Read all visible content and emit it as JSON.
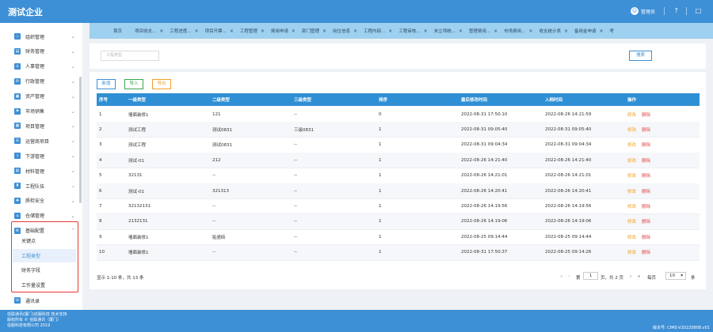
{
  "header": {
    "title": "测试企业",
    "user_name": "管理员",
    "help_icon": "?",
    "device_icon": "□"
  },
  "tabs": [
    "首页",
    "项目收支...",
    "工程进度...",
    "项目开票...",
    "工程管理",
    "费用申请",
    "部门管理",
    "岗位信息",
    "工程内部...",
    "工程审核...",
    "末立项统...",
    "管理费用...",
    "市场费用...",
    "收支统计表",
    "备用金申请",
    "考"
  ],
  "sidebar": {
    "items": [
      "组织管理",
      "财务管理",
      "人事管理",
      "行政管理",
      "资产管理",
      "市场销售",
      "项目管理",
      "运营商项目",
      "下游管理",
      "材料管理",
      "工程队伍",
      "质检安全",
      "仓储管理",
      "基础配置"
    ],
    "subitems": [
      "关键点",
      "工程类型",
      "财务字段",
      "工作量设置"
    ],
    "last_item": "通讯录"
  },
  "search": {
    "placeholder": "工程类型",
    "button": "搜索"
  },
  "actions": {
    "add": "新增",
    "import": "导入",
    "export": "导出"
  },
  "table": {
    "headers": [
      "序号",
      "一级类型",
      "二级类型",
      "三级类型",
      "排序",
      "最后修改时间",
      "入档时间",
      "操作"
    ],
    "rows": [
      [
        "1",
        "墙面装修1",
        "121",
        "--",
        "0",
        "2022-08-31 17:50:10",
        "2022-08-26 14:21:59"
      ],
      [
        "2",
        "测试工程",
        "测试0831",
        "三级0831",
        "1",
        "2022-08-31 09:05:40",
        "2022-08-31 09:05:40"
      ],
      [
        "3",
        "测试工程",
        "测试0831",
        "--",
        "1",
        "2022-08-31 09:04:34",
        "2022-08-31 09:04:34"
      ],
      [
        "4",
        "测试-01",
        "212",
        "--",
        "1",
        "2022-08-26 14:21:40",
        "2022-08-26 14:21:40"
      ],
      [
        "5",
        "32131",
        "--",
        "--",
        "1",
        "2022-08-26 14:21:01",
        "2022-08-26 14:21:01"
      ],
      [
        "6",
        "测试-01",
        "321313",
        "--",
        "1",
        "2022-08-26 14:20:41",
        "2022-08-26 14:20:41"
      ],
      [
        "7",
        "32132131",
        "--",
        "--",
        "1",
        "2022-08-26 14:19:56",
        "2022-08-26 14:19:56"
      ],
      [
        "8",
        "2132131",
        "--",
        "--",
        "1",
        "2022-08-26 14:19:06",
        "2022-08-26 14:19:06"
      ],
      [
        "9",
        "墙面装修1",
        "贴瓷砖",
        "--",
        "1",
        "2022-08-25 09:14:44",
        "2022-08-25 09:14:44"
      ],
      [
        "10",
        "墙面装修1",
        "--",
        "--",
        "1",
        "2022-08-31 17:50:37",
        "2022-08-25 09:14:26"
      ]
    ],
    "edit_label": "修改",
    "delete_label": "删除"
  },
  "pagination": {
    "summary": "显示 1-10 条，共 13 条",
    "first": "«",
    "prev": "‹",
    "page_label": "第",
    "page": "1",
    "total_pages": "页，共 2 页",
    "next": "›",
    "last": "»",
    "per_page_label": "每页",
    "per_page": "10",
    "per_page_unit": "条"
  },
  "footer": {
    "line1": "信联通讯(厦门)信服科技 技术支持",
    "line2": "版权所有 © 信联通讯（厦门）",
    "line3": "信服科技有限公司 2019",
    "version": "版本号: CIMS-V20220808.v01"
  }
}
